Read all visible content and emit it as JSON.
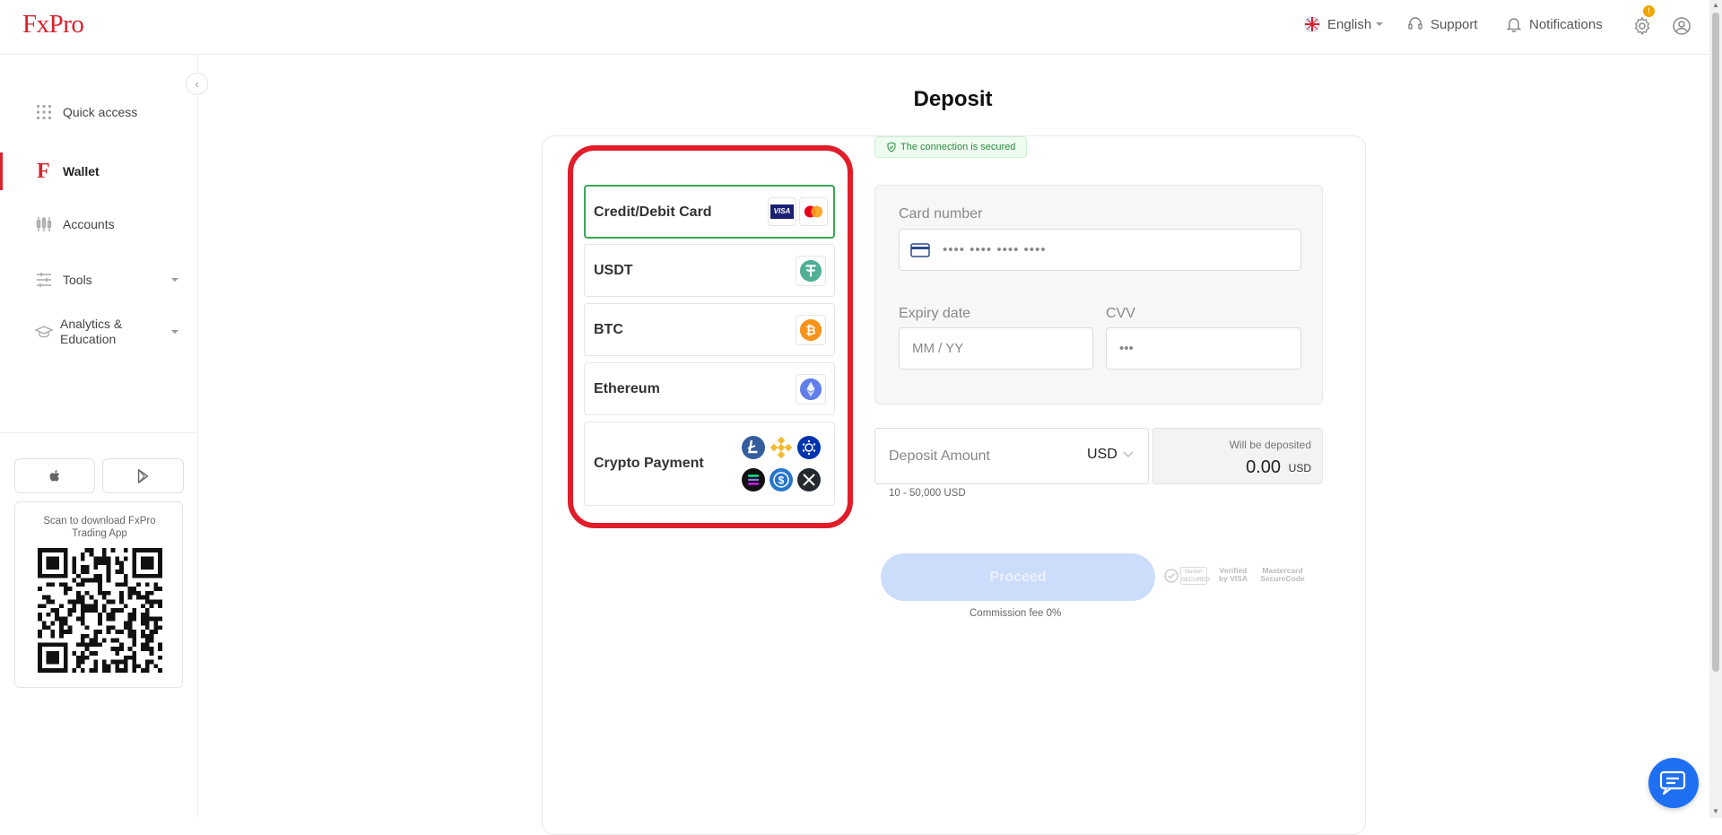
{
  "header": {
    "logo": "FxPro",
    "language": "English",
    "support": "Support",
    "notifications": "Notifications",
    "settings_badge": "!"
  },
  "sidebar": {
    "items": [
      {
        "label": "Quick access",
        "icon": "grid-icon"
      },
      {
        "label": "Wallet",
        "icon": "fxpro-f-icon",
        "active": true
      },
      {
        "label": "Accounts",
        "icon": "candlestick-icon"
      },
      {
        "label": "Tools",
        "icon": "sliders-icon",
        "has_dropdown": true
      },
      {
        "label": "Analytics & Education",
        "icon": "graduation-cap-icon",
        "has_dropdown": true
      }
    ],
    "qr_text": "Scan to download FxPro Trading App"
  },
  "main": {
    "title": "Deposit",
    "secure_text": "The connection is secured",
    "methods": [
      {
        "label": "Credit/Debit Card",
        "selected": true
      },
      {
        "label": "USDT"
      },
      {
        "label": "BTC"
      },
      {
        "label": "Ethereum"
      },
      {
        "label": "Crypto Payment"
      }
    ],
    "form": {
      "card_number_label": "Card number",
      "card_number_placeholder": "•••• •••• •••• ••••",
      "expiry_label": "Expiry date",
      "expiry_placeholder": "MM / YY",
      "cvv_label": "CVV",
      "cvv_placeholder": "•••",
      "amount_placeholder": "Deposit Amount",
      "currency": "USD",
      "range": "10 - 50,000 USD",
      "will_be_deposited_label": "Will be deposited",
      "will_be_deposited_value": "0.00",
      "will_be_deposited_currency": "USD",
      "proceed": "Proceed",
      "commission": "Commission fee 0%",
      "security_logos": [
        "Norton SECURED",
        "Verified by VISA",
        "Mastercard SecureCode"
      ]
    }
  },
  "colors": {
    "brand_red": "#d9232d",
    "highlight_red": "#e11d2a",
    "selected_green": "#3aa655",
    "proceed_disabled": "#ccdcfb",
    "chat_blue": "#1f6ff2"
  }
}
